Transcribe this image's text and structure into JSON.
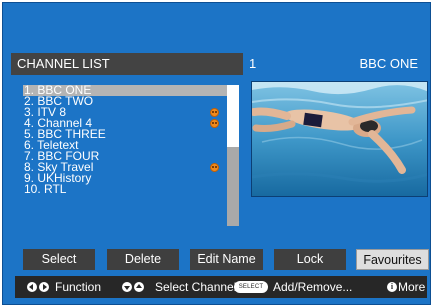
{
  "header": {
    "title": "CHANNEL LIST",
    "channel_number": "1",
    "channel_name": "BBC ONE"
  },
  "channels": [
    {
      "label": "1. BBC ONE",
      "selected": true,
      "favourite": false
    },
    {
      "label": "2. BBC TWO",
      "selected": false,
      "favourite": false
    },
    {
      "label": "3. ITV 8",
      "selected": false,
      "favourite": true
    },
    {
      "label": "4. Channel 4",
      "selected": false,
      "favourite": true
    },
    {
      "label": "5. BBC THREE",
      "selected": false,
      "favourite": false
    },
    {
      "label": "6. Teletext",
      "selected": false,
      "favourite": false
    },
    {
      "label": "7. BBC FOUR",
      "selected": false,
      "favourite": false
    },
    {
      "label": "8. Sky Travel",
      "selected": false,
      "favourite": true
    },
    {
      "label": "9. UKHistory",
      "selected": false,
      "favourite": false
    },
    {
      "label": "10. RTL",
      "selected": false,
      "favourite": false
    }
  ],
  "preview": {
    "icon": "swimmer-preview-image"
  },
  "buttons": {
    "select": "Select",
    "delete": "Delete",
    "edit_name": "Edit Name",
    "lock": "Lock",
    "favourites": "Favourites"
  },
  "help": {
    "function": "Function",
    "select_channel": "Select Channel",
    "select_key": "SELECT",
    "add_remove": "Add/Remove...",
    "more": "More",
    "info_key": "i"
  },
  "colors": {
    "background": "#1c74c6",
    "panel": "#434343",
    "highlight": "#b4b4b4",
    "favourite": "#f08a1c"
  }
}
